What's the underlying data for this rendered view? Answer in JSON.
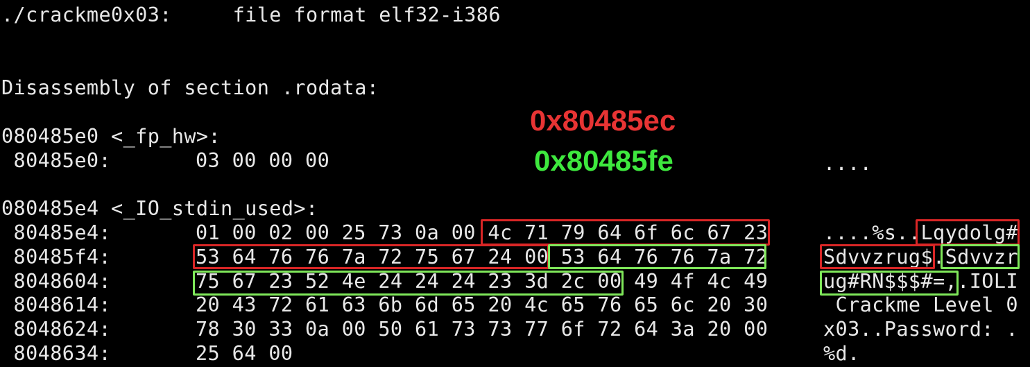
{
  "colors": {
    "background": "#000000",
    "text": "#e8e8e8",
    "red": "#e83434",
    "green": "#3ee83e",
    "box_red": "#d92626",
    "box_green": "#7fe85a"
  },
  "header": {
    "file_line": "./crackme0x03:     file format elf32-i386",
    "disasm_line": "Disassembly of section .rodata:"
  },
  "annotations": {
    "red_address": "0x80485ec",
    "green_address": "0x80485fe"
  },
  "sections": [
    {
      "label": "080485e0 <_fp_hw>:",
      "rows": [
        {
          "address": " 80485e0:",
          "hex": "03 00 00 00",
          "ascii": "...."
        }
      ]
    },
    {
      "label": "080485e4 <_IO_stdin_used>:",
      "rows": [
        {
          "address": " 80485e4:",
          "hex": "01 00 02 00 25 73 0a 00 4c 71 79 64 6f 6c 67 23",
          "ascii": "....%s..Lqydolg#"
        },
        {
          "address": " 80485f4:",
          "hex": "53 64 76 76 7a 72 75 67 24 00 53 64 76 76 7a 72",
          "ascii": "Sdvvzrug$.Sdvvzr"
        },
        {
          "address": " 8048604:",
          "hex": "75 67 23 52 4e 24 24 24 23 3d 2c 00 49 4f 4c 49",
          "ascii": "ug#RN$$$#=,.IOLI"
        },
        {
          "address": " 8048614:",
          "hex": "20 43 72 61 63 6b 6d 65 20 4c 65 76 65 6c 20 30",
          "ascii": " Crackme Level 0"
        },
        {
          "address": " 8048624:",
          "hex": "78 30 33 0a 00 50 61 73 73 77 6f 72 64 3a 20 00",
          "ascii": "x03..Password: ."
        },
        {
          "address": " 8048634:",
          "hex": "25 64 00",
          "ascii": "%d."
        }
      ]
    }
  ]
}
